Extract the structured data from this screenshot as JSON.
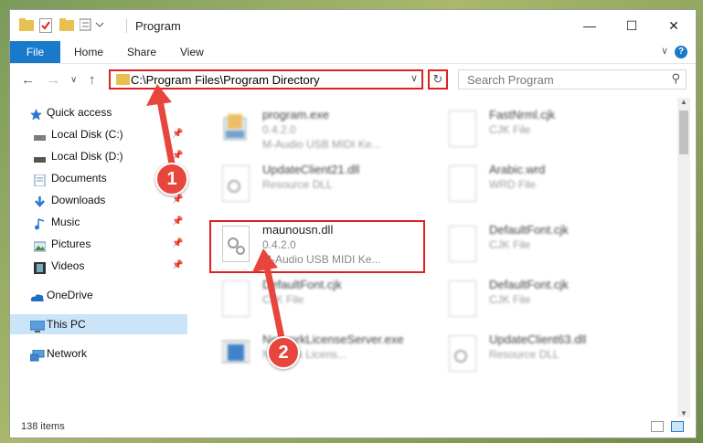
{
  "window": {
    "title": "Program"
  },
  "ribbon": {
    "file_label": "File",
    "tabs": [
      "Home",
      "Share",
      "View"
    ],
    "help_label": "?"
  },
  "address": {
    "path": "C:\\Program Files\\Program Directory",
    "search_placeholder": "Search Program"
  },
  "nav": {
    "items": [
      {
        "label": "Quick access",
        "icon": "star-icon"
      },
      {
        "label": "Local Disk (C:)",
        "icon": "drive-icon"
      },
      {
        "label": "Local Disk (D:)",
        "icon": "drive-icon"
      },
      {
        "label": "Documents",
        "icon": "documents-icon"
      },
      {
        "label": "Downloads",
        "icon": "downloads-icon"
      },
      {
        "label": "Music",
        "icon": "music-icon"
      },
      {
        "label": "Pictures",
        "icon": "pictures-icon"
      },
      {
        "label": "Videos",
        "icon": "videos-icon"
      },
      {
        "label": "OneDrive",
        "icon": "cloud-icon"
      },
      {
        "label": "This PC",
        "icon": "computer-icon"
      },
      {
        "label": "Network",
        "icon": "network-icon"
      }
    ]
  },
  "files": [
    {
      "name": "program.exe",
      "line2": "0.4.2.0",
      "line3": "M-Audio USB MIDI Ke..."
    },
    {
      "name": "FastNrml.cjk",
      "line2": "CJK File",
      "line3": ""
    },
    {
      "name": "UpdateClient21.dll",
      "line2": "Resource DLL",
      "line3": ""
    },
    {
      "name": "Arabic.wrd",
      "line2": "WRD File",
      "line3": ""
    },
    {
      "name": "maunousn.dll",
      "line2": "0.4.2.0",
      "line3": "M-Audio USB MIDI Ke..."
    },
    {
      "name": "DefaultFont.cjk",
      "line2": "CJK File",
      "line3": ""
    },
    {
      "name": "DefaultFont.cjk",
      "line2": "CJK File",
      "line3": ""
    },
    {
      "name": "DefaultFont.cjk",
      "line2": "CJK File",
      "line3": ""
    },
    {
      "name": "NetworkLicenseServer.exe",
      "line2": "Network Licens...",
      "line3": ""
    },
    {
      "name": "UpdateClient63.dll",
      "line2": "Resource DLL",
      "line3": ""
    }
  ],
  "status": {
    "items_count": "138 items"
  },
  "annotations": {
    "step1": "1",
    "step2": "2",
    "color": "#e8453c"
  }
}
